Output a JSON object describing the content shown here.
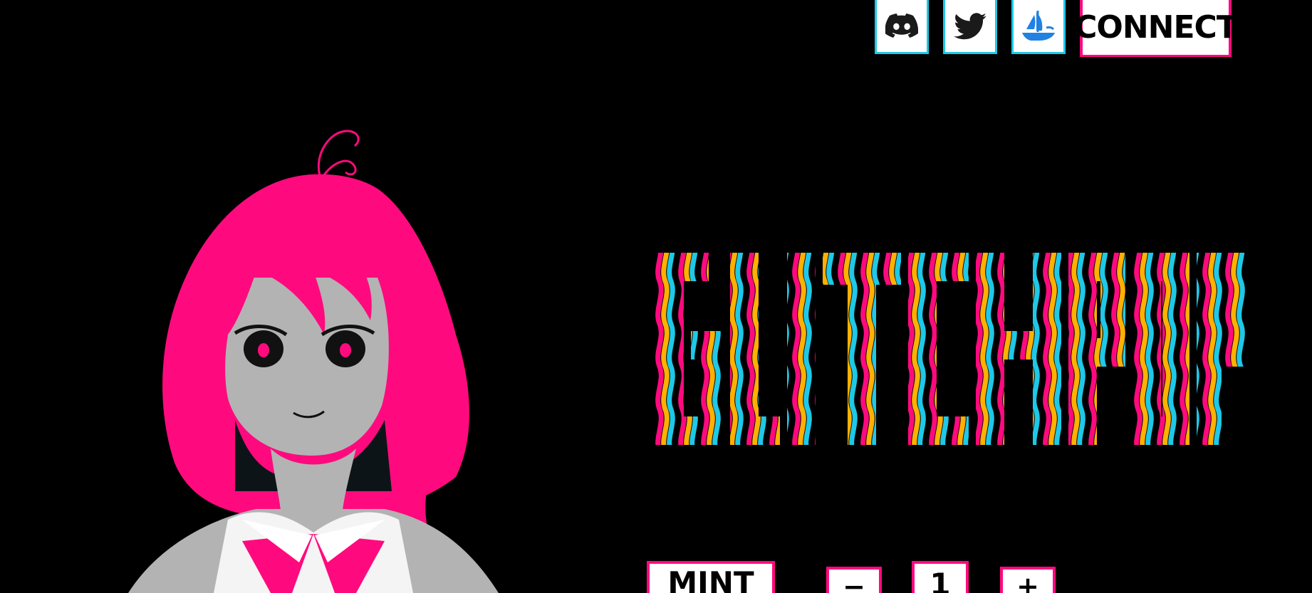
{
  "nav": {
    "discord_icon": "discord-icon",
    "twitter_icon": "twitter-icon",
    "opensea_icon": "opensea-icon",
    "connect_label": "CONNECT"
  },
  "mint": {
    "mint_label": "MINT",
    "decrement_label": "−",
    "quantity": "1",
    "increment_label": "+"
  },
  "colors": {
    "background": "#000000",
    "pink": "#ff0a7e",
    "cyan": "#1ec8e6",
    "orange": "#ffb000",
    "green": "#1ee87a",
    "skin": "#b3b3b3",
    "shirt": "#f4f4f4",
    "discord_blue": "#2b2b2b",
    "opensea_blue": "#2081e2"
  }
}
